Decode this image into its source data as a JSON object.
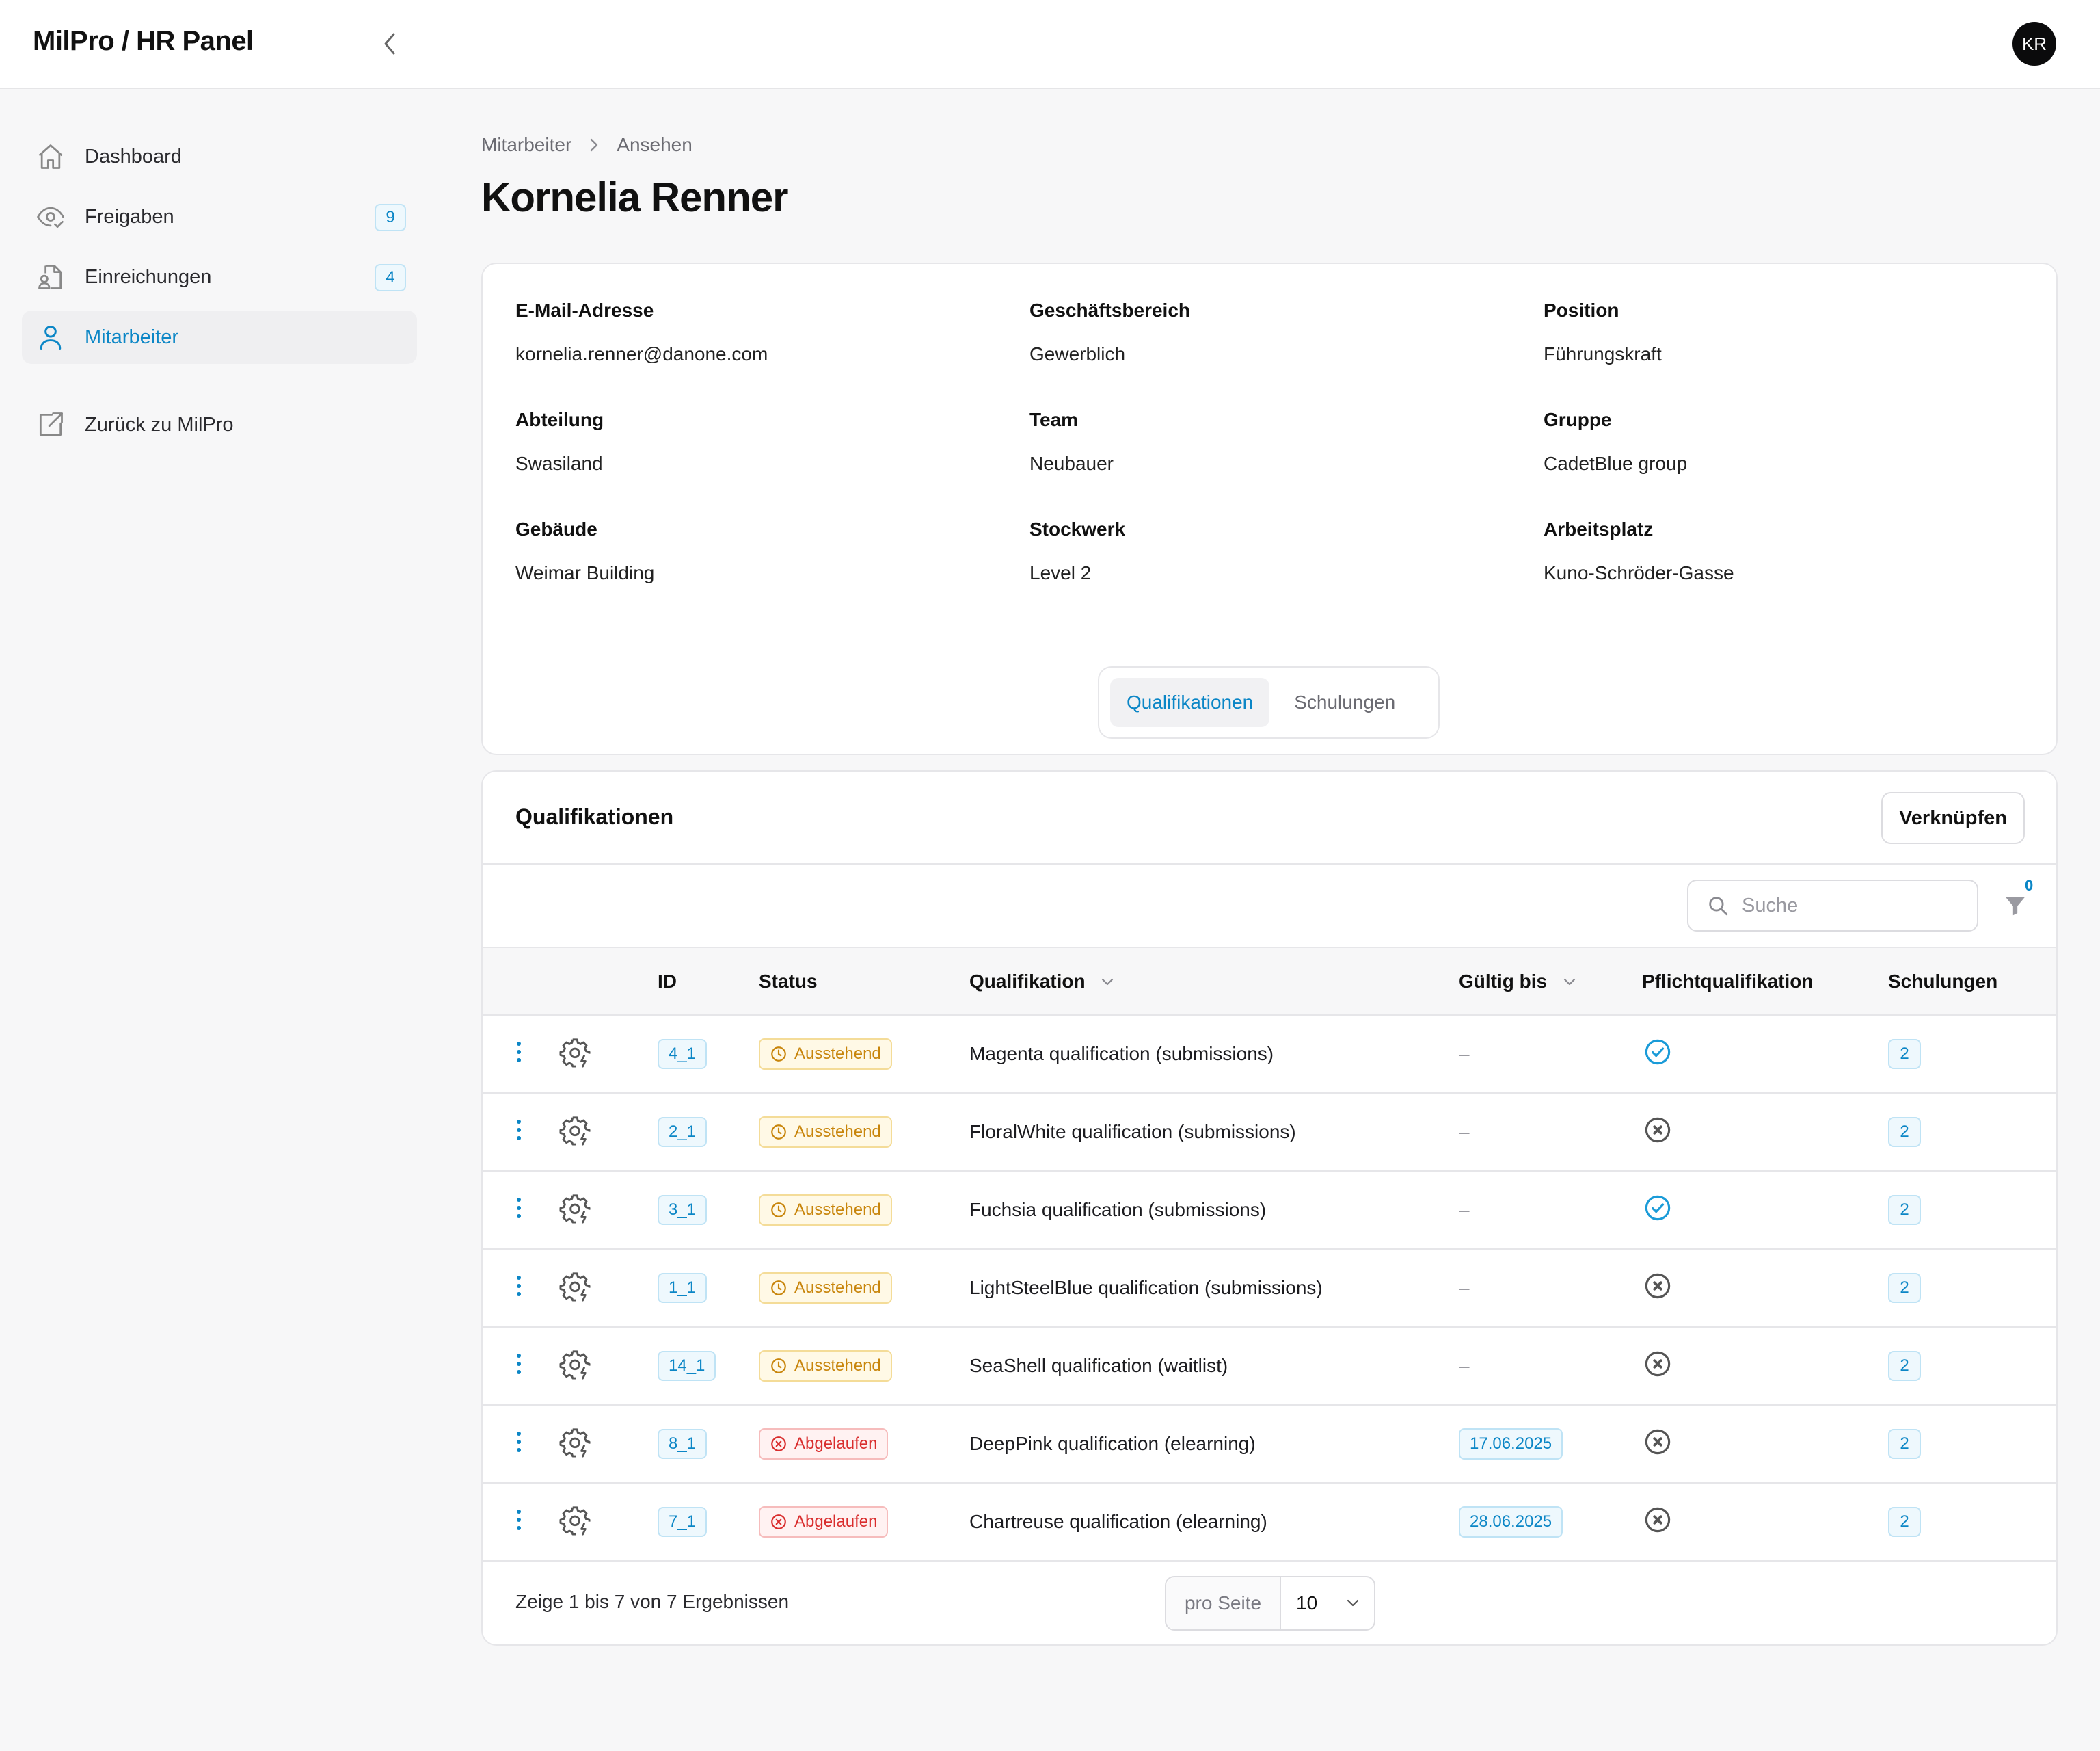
{
  "app": {
    "title": "MilPro / HR Panel",
    "user_initials": "KR"
  },
  "sidebar": {
    "items": [
      {
        "label": "Dashboard",
        "icon": "home-icon",
        "badge": null,
        "active": false
      },
      {
        "label": "Freigaben",
        "icon": "eye-check-icon",
        "badge": "9",
        "active": false
      },
      {
        "label": "Einreichungen",
        "icon": "document-user-icon",
        "badge": "4",
        "active": false
      },
      {
        "label": "Mitarbeiter",
        "icon": "user-icon",
        "badge": null,
        "active": true
      }
    ],
    "back_link": {
      "label": "Zurück zu MilPro",
      "icon": "external-link-icon"
    }
  },
  "breadcrumb": {
    "parent": "Mitarbeiter",
    "current": "Ansehen"
  },
  "page_title": "Kornelia Renner",
  "employee": {
    "fields": [
      {
        "label": "E-Mail-Adresse",
        "value": "kornelia.renner@danone.com"
      },
      {
        "label": "Geschäftsbereich",
        "value": "Gewerblich"
      },
      {
        "label": "Position",
        "value": "Führungskraft"
      },
      {
        "label": "Abteilung",
        "value": "Swasiland"
      },
      {
        "label": "Team",
        "value": "Neubauer"
      },
      {
        "label": "Gruppe",
        "value": "CadetBlue group"
      },
      {
        "label": "Gebäude",
        "value": "Weimar Building"
      },
      {
        "label": "Stockwerk",
        "value": "Level 2"
      },
      {
        "label": "Arbeitsplatz",
        "value": "Kuno-Schröder-Gasse"
      }
    ]
  },
  "tabs": [
    {
      "label": "Qualifikationen",
      "active": true
    },
    {
      "label": "Schulungen",
      "active": false
    }
  ],
  "qualifications": {
    "title": "Qualifikationen",
    "link_button": "Verknüpfen",
    "search_placeholder": "Suche",
    "filter_count": "0",
    "columns": {
      "id": "ID",
      "status": "Status",
      "qualification": "Qualifikation",
      "valid_until": "Gültig bis",
      "mandatory": "Pflichtqualifikation",
      "trainings": "Schulungen"
    },
    "rows": [
      {
        "id": "4_1",
        "status": "Ausstehend",
        "status_type": "pending",
        "name": "Magenta qualification (submissions)",
        "valid_until": "–",
        "mandatory": true,
        "trainings": "2"
      },
      {
        "id": "2_1",
        "status": "Ausstehend",
        "status_type": "pending",
        "name": "FloralWhite qualification (submissions)",
        "valid_until": "–",
        "mandatory": false,
        "trainings": "2"
      },
      {
        "id": "3_1",
        "status": "Ausstehend",
        "status_type": "pending",
        "name": "Fuchsia qualification (submissions)",
        "valid_until": "–",
        "mandatory": true,
        "trainings": "2"
      },
      {
        "id": "1_1",
        "status": "Ausstehend",
        "status_type": "pending",
        "name": "LightSteelBlue qualification (submissions)",
        "valid_until": "–",
        "mandatory": false,
        "trainings": "2"
      },
      {
        "id": "14_1",
        "status": "Ausstehend",
        "status_type": "pending",
        "name": "SeaShell qualification (waitlist)",
        "valid_until": "–",
        "mandatory": false,
        "trainings": "2"
      },
      {
        "id": "8_1",
        "status": "Abgelaufen",
        "status_type": "expired",
        "name": "DeepPink qualification (elearning)",
        "valid_until": "17.06.2025",
        "mandatory": false,
        "trainings": "2"
      },
      {
        "id": "7_1",
        "status": "Abgelaufen",
        "status_type": "expired",
        "name": "Chartreuse qualification (elearning)",
        "valid_until": "28.06.2025",
        "mandatory": false,
        "trainings": "2"
      }
    ],
    "results_text": "Zeige 1 bis 7 von 7 Ergebnissen",
    "per_page_label": "pro Seite",
    "per_page_value": "10"
  },
  "colors": {
    "accent": "#0b86c6",
    "pending": "#c8850b",
    "expired": "#d92d2d",
    "check": "#1a9bd8"
  }
}
